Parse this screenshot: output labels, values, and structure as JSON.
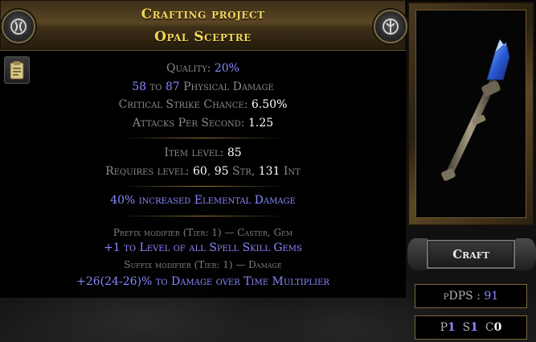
{
  "header": {
    "line1": "Crafting project",
    "line2": "Opal Sceptre"
  },
  "icons": {
    "left_emblem": "shaper-emblem-icon",
    "right_emblem": "elder-emblem-icon",
    "clipboard": "clipboard-icon"
  },
  "properties": {
    "quality_label": "Quality: ",
    "quality_value": "20%",
    "phys_min": "58",
    "phys_to": " to ",
    "phys_max": "87",
    "phys_label": " Physical Damage",
    "crit_label": "Critical Strike Chance: ",
    "crit_value": "6.50%",
    "aps_label": "Attacks Per Second: ",
    "aps_value": "1.25"
  },
  "requirements": {
    "ilvl_label": "Item level: ",
    "ilvl_value": "85",
    "req_label": "Requires level: ",
    "req_level": "60",
    "sep1": ", ",
    "req_str": "95",
    "str_label": " Str, ",
    "req_int": "131",
    "int_label": " Int"
  },
  "implicit": "40% increased Elemental Damage",
  "modifiers": {
    "prefix_label": "Prefix modifier (Tier: 1) — Caster, Gem",
    "prefix_text": "+1 to Level of all Spell Skill Gems",
    "suffix_label": "Suffix modifier (Tier: 1) — Damage",
    "suffix_text": "+26(24-26)% to Damage over Time Multiplier"
  },
  "actions": {
    "craft_label": "Craft"
  },
  "stats": {
    "pdps_label": "pDPS : ",
    "pdps_value": "91",
    "p_label": "P",
    "p_value": "1",
    "s_label": "S",
    "s_value": "1",
    "c_label": "C",
    "c_value": "0"
  },
  "colors": {
    "title": "#f3d65b",
    "magic_blue": "#8888ff",
    "label_grey": "#8a8a8a",
    "value_white": "#ffffff",
    "frame_gold": "#7a6838"
  }
}
